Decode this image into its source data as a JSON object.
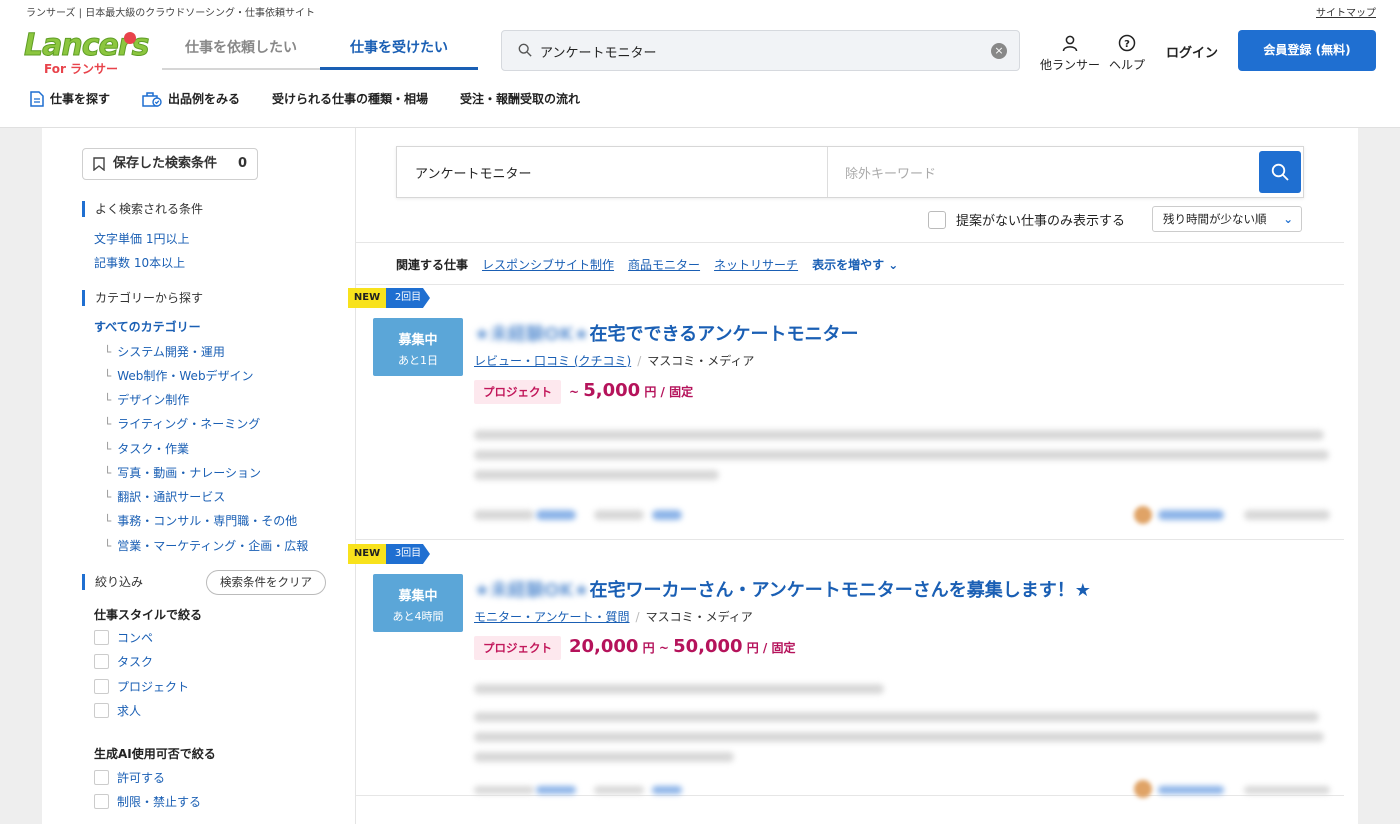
{
  "header": {
    "tagline": "ランサーズ | 日本最大級のクラウドソーシング・仕事依頼サイト",
    "sitemap": "サイトマップ",
    "logo_main": "Lancers",
    "logo_sub": "For ランサー",
    "tabs": [
      {
        "label": "仕事を依頼したい",
        "active": false
      },
      {
        "label": "仕事を受けたい",
        "active": true
      }
    ],
    "search_value": "アンケートモニター",
    "other_lancers": "他ランサー",
    "help": "ヘルプ",
    "login": "ログイン",
    "register": "会員登録 (無料)"
  },
  "subnav": {
    "items": [
      {
        "label": "仕事を探す",
        "icon": "document-icon"
      },
      {
        "label": "出品例をみる",
        "icon": "bag-icon"
      },
      {
        "label": "受けられる仕事の種類・相場",
        "icon": ""
      },
      {
        "label": "受注・報酬受取の流れ",
        "icon": ""
      }
    ]
  },
  "sidebar": {
    "saved_label": "保存した検索条件",
    "saved_count": "0",
    "popular_title": "よく検索される条件",
    "popular": [
      "文字単価 1円以上",
      "記事数 10本以上"
    ],
    "category_title": "カテゴリーから探す",
    "all_categories": "すべてのカテゴリー",
    "categories": [
      "システム開発・運用",
      "Web制作・Webデザイン",
      "デザイン制作",
      "ライティング・ネーミング",
      "タスク・作業",
      "写真・動画・ナレーション",
      "翻訳・通訳サービス",
      "事務・コンサル・専門職・その他",
      "営業・マーケティング・企画・広報"
    ],
    "filter_title": "絞り込み",
    "clear_button": "検索条件をクリア",
    "style_label": "仕事スタイルで絞る",
    "styles": [
      "コンペ",
      "タスク",
      "プロジェクト",
      "求人"
    ],
    "ai_label": "生成AI使用可否で絞る",
    "ai_options": [
      "許可する",
      "制限・禁止する"
    ]
  },
  "content": {
    "keyword": "アンケートモニター",
    "exclude_placeholder": "除外キーワード",
    "no_proposal": "提案がない仕事のみ表示する",
    "sort": "残り時間が少ない順",
    "related_label": "関連する仕事",
    "related": [
      "レスポンシブサイト制作",
      "商品モニター",
      "ネットリサーチ"
    ],
    "related_more": "表示を増やす"
  },
  "jobs": [
    {
      "new_badge": "NEW",
      "round_badge": "2回目",
      "status": "募集中",
      "remaining": "あと1日",
      "title_blur": "★未経験OK★",
      "title": "在宅でできるアンケートモニター",
      "category_link": "レビュー・口コミ (クチコミ)",
      "category_text": "マスコミ・メディア",
      "type": "プロジェクト",
      "price_prefix": "~",
      "price_min": "",
      "price_max": "5,000",
      "price_suffix": "円 / 固定"
    },
    {
      "new_badge": "NEW",
      "round_badge": "3回目",
      "status": "募集中",
      "remaining": "あと4時間",
      "title_blur": "★未経験OK★",
      "title": "在宅ワーカーさん・アンケートモニターさんを募集します！★",
      "category_link": "モニター・アンケート・質問",
      "category_text": "マスコミ・メディア",
      "type": "プロジェクト",
      "price_min": "20,000",
      "price_mid": "円 ~ ",
      "price_max": "50,000",
      "price_suffix": "円 / 固定"
    }
  ],
  "colors": {
    "brand_blue": "#1f6fd1",
    "status_blue": "#5ba6d8",
    "price_red": "#b5135b",
    "new_yellow": "#f8e21c"
  }
}
